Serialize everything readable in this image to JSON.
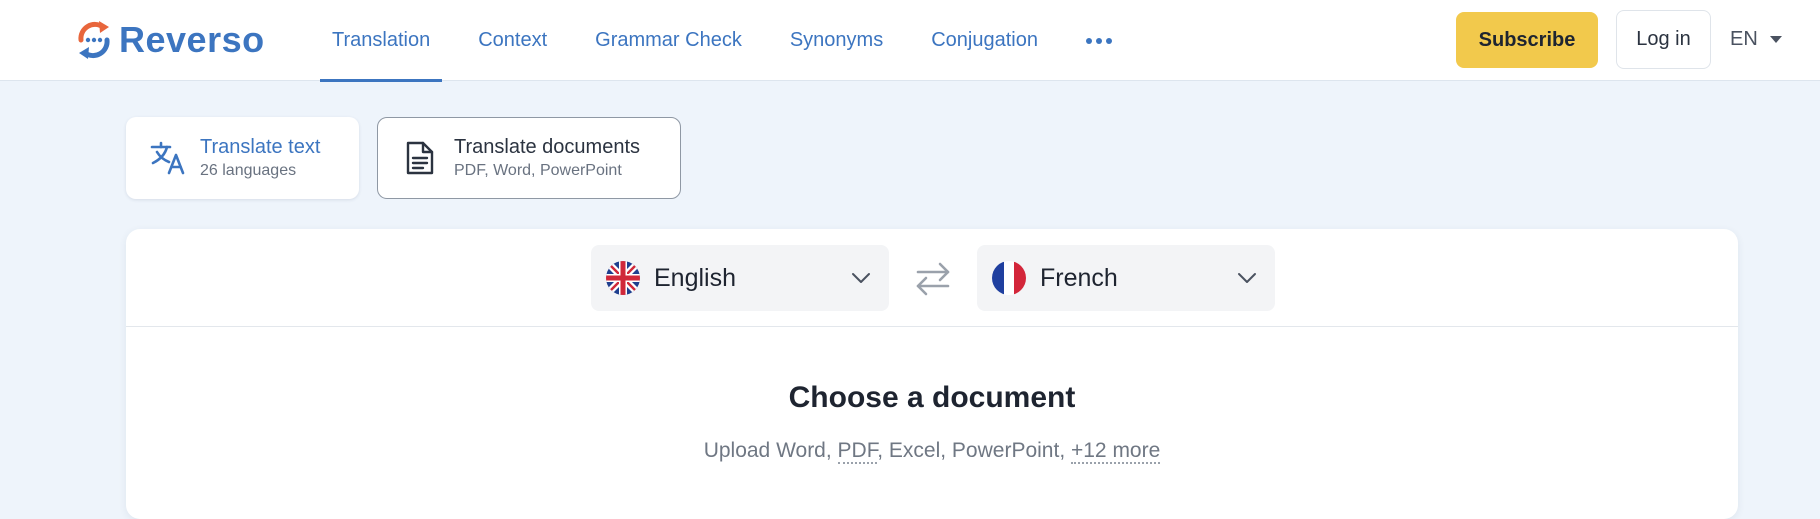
{
  "header": {
    "logo_text": "Reverso",
    "nav": [
      {
        "label": "Translation",
        "active": true
      },
      {
        "label": "Context",
        "active": false
      },
      {
        "label": "Grammar Check",
        "active": false
      },
      {
        "label": "Synonyms",
        "active": false
      },
      {
        "label": "Conjugation",
        "active": false
      }
    ],
    "more_icon": "more-dots-icon",
    "subscribe_label": "Subscribe",
    "login_label": "Log in",
    "ui_language": "EN"
  },
  "modes": {
    "text": {
      "title": "Translate text",
      "subtitle": "26 languages",
      "icon": "translate-icon"
    },
    "documents": {
      "title": "Translate documents",
      "subtitle": "PDF, Word, PowerPoint",
      "icon": "document-icon"
    }
  },
  "languages": {
    "source": {
      "name": "English",
      "flag": "uk-flag-icon"
    },
    "target": {
      "name": "French",
      "flag": "france-flag-icon"
    },
    "swap_icon": "swap-arrows-icon"
  },
  "upload": {
    "title": "Choose a document",
    "prefix": "Upload Word, ",
    "pdf": "PDF",
    "middle": ", Excel, PowerPoint, ",
    "more": "+12 more"
  },
  "colors": {
    "brand_blue": "#3c75c0",
    "logo_orange": "#e8663c",
    "subscribe_yellow": "#f2c94c",
    "page_bg": "#eef4fb"
  }
}
